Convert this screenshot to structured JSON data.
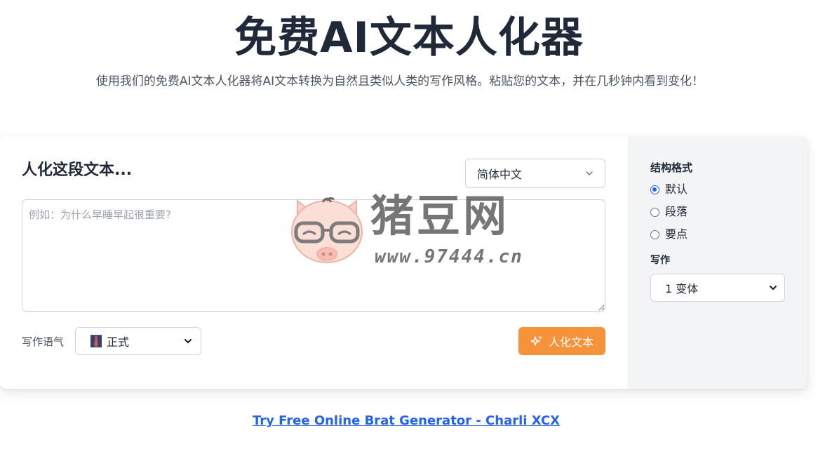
{
  "hero": {
    "title": "免费AI文本人化器",
    "subtitle": "使用我们的免费AI文本人化器将AI文本转换为自然且类似人类的写作风格。粘贴您的文本，并在几秒钟内看到变化！"
  },
  "editor": {
    "heading": "人化这段文本...",
    "language_selected": "简体中文",
    "input_value": "",
    "input_placeholder": "例如：为什么早睡早起很重要?",
    "tone_label": "写作语气",
    "tone_selected": "正式",
    "humanize_label": "人化文本"
  },
  "sidebar": {
    "format_label": "结构格式",
    "format_options": [
      {
        "label": "默认",
        "checked": true
      },
      {
        "label": "段落",
        "checked": false
      },
      {
        "label": "要点",
        "checked": false
      }
    ],
    "writing_label": "写作",
    "variant_selected": "1 变体"
  },
  "footer": {
    "link_text": "Try Free Online Brat Generator - Charli XCX"
  },
  "watermark": {
    "title": "猪豆网",
    "url": "www.97444.cn"
  },
  "colors": {
    "accent_orange": "#f6923a",
    "link_blue": "#2563eb",
    "sidebar_bg": "#f3f4f6"
  }
}
